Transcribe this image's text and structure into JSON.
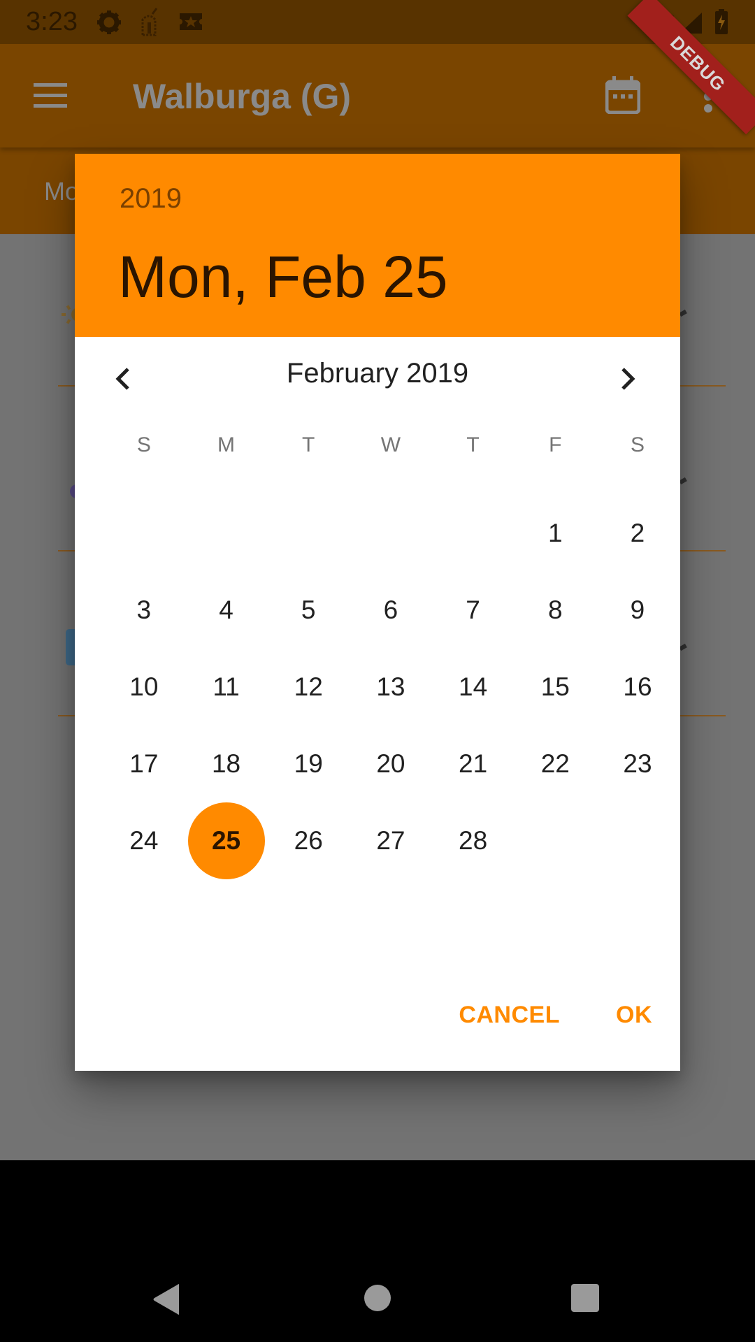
{
  "status_bar": {
    "time": "3:23",
    "icons_left": [
      "gear-icon",
      "app-notification-icon",
      "ticket-star-icon"
    ],
    "icons_right": [
      "wifi-icon",
      "signal-icon",
      "battery-charging-icon"
    ]
  },
  "debug_banner": "DEBUG",
  "app_bar": {
    "title": "Walburga (G)",
    "icons": [
      "menu-icon",
      "calendar-icon",
      "more-vert-icon"
    ]
  },
  "tab_strip": {
    "visible_label": "Mo"
  },
  "date_picker": {
    "header_year": "2019",
    "header_date": "Mon, Feb 25",
    "month_label": "February 2019",
    "weekdays": [
      "S",
      "M",
      "T",
      "W",
      "T",
      "F",
      "S"
    ],
    "leading_blanks": 5,
    "days": [
      "1",
      "2",
      "3",
      "4",
      "5",
      "6",
      "7",
      "8",
      "9",
      "10",
      "11",
      "12",
      "13",
      "14",
      "15",
      "16",
      "17",
      "18",
      "19",
      "20",
      "21",
      "22",
      "23",
      "24",
      "25",
      "26",
      "27",
      "28"
    ],
    "selected_day": "25",
    "cancel_label": "CANCEL",
    "ok_label": "OK",
    "accent_color": "#FF8A00"
  },
  "nav_bar": {
    "buttons": [
      "back",
      "home",
      "recents"
    ]
  }
}
